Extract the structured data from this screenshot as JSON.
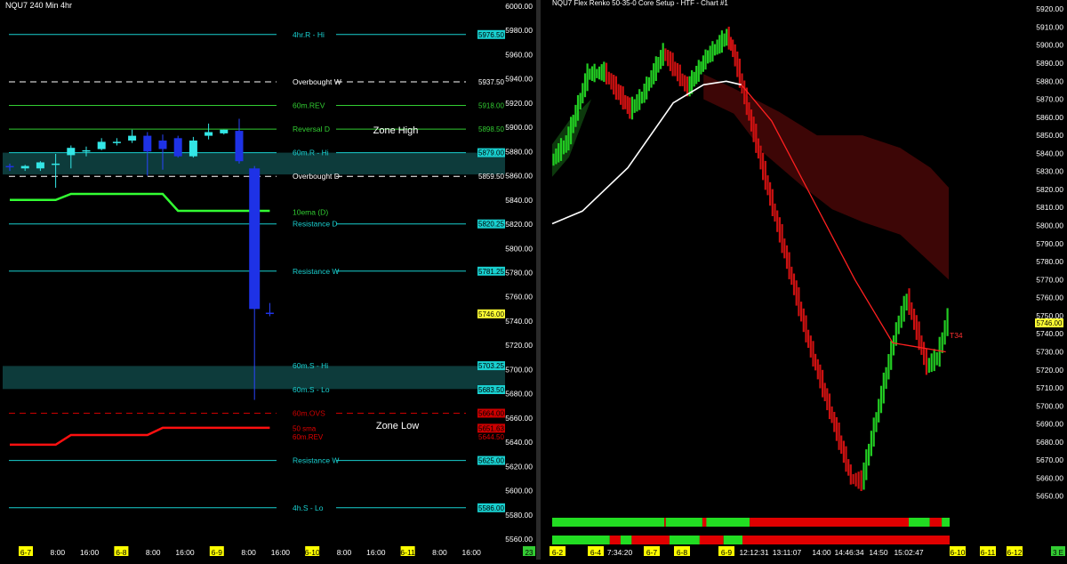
{
  "chart_data": [
    {
      "type": "candlestick",
      "title": "NQU7 240 Min  4hr",
      "ylim": [
        5555,
        6005
      ],
      "y_ticks": [
        6000,
        5980,
        5960,
        5940,
        5920,
        5900,
        5880,
        5860,
        5840,
        5820,
        5800,
        5780,
        5760,
        5740,
        5720,
        5700,
        5680,
        5660,
        5640,
        5620,
        5600,
        5580,
        5560
      ],
      "y_tick_labels": [
        "6000.00",
        "5980.00",
        "5960.00",
        "5940.00",
        "5920.00",
        "5900.00",
        "5880.00",
        "5860.00",
        "5840.00",
        "5820.00",
        "5800.00",
        "5780.00",
        "5760.00",
        "5740.00",
        "5720.00",
        "5700.00",
        "5680.00",
        "5660.00",
        "5640.00",
        "5620.00",
        "5600.00",
        "5580.00",
        "5560.00"
      ],
      "x_ticks": [
        {
          "label": "6-7",
          "highlight": true
        },
        {
          "label": "8:00",
          "highlight": false
        },
        {
          "label": "16:00",
          "highlight": false
        },
        {
          "label": "6-8",
          "highlight": true
        },
        {
          "label": "8:00",
          "highlight": false
        },
        {
          "label": "16:00",
          "highlight": false
        },
        {
          "label": "6-9",
          "highlight": true
        },
        {
          "label": "8:00",
          "highlight": false
        },
        {
          "label": "16:00",
          "highlight": false
        },
        {
          "label": "6-10",
          "highlight": true
        },
        {
          "label": "8:00",
          "highlight": false
        },
        {
          "label": "16:00",
          "highlight": false
        },
        {
          "label": "6-11",
          "highlight": true
        },
        {
          "label": "8:00",
          "highlight": false
        },
        {
          "label": "16:00",
          "highlight": false
        }
      ],
      "corner_label": "23",
      "candles": [
        {
          "o": 5868,
          "h": 5870,
          "l": 5864,
          "c": 5867
        },
        {
          "o": 5866,
          "h": 5869,
          "l": 5864,
          "c": 5868
        },
        {
          "o": 5866,
          "h": 5872,
          "l": 5864,
          "c": 5871
        },
        {
          "o": 5869,
          "h": 5878,
          "l": 5850,
          "c": 5870
        },
        {
          "o": 5877,
          "h": 5885,
          "l": 5866,
          "c": 5883
        },
        {
          "o": 5880,
          "h": 5884,
          "l": 5876,
          "c": 5881
        },
        {
          "o": 5882,
          "h": 5891,
          "l": 5881,
          "c": 5888
        },
        {
          "o": 5887,
          "h": 5891,
          "l": 5885,
          "c": 5888
        },
        {
          "o": 5889,
          "h": 5898,
          "l": 5887,
          "c": 5893
        },
        {
          "o": 5893,
          "h": 5896,
          "l": 5860,
          "c": 5880
        },
        {
          "o": 5889,
          "h": 5894,
          "l": 5865,
          "c": 5882
        },
        {
          "o": 5891,
          "h": 5893,
          "l": 5875,
          "c": 5876
        },
        {
          "o": 5876,
          "h": 5892,
          "l": 5875,
          "c": 5889
        },
        {
          "o": 5893,
          "h": 5903,
          "l": 5890,
          "c": 5896
        },
        {
          "o": 5895,
          "h": 5898,
          "l": 5894,
          "c": 5898
        },
        {
          "o": 5897,
          "h": 5907,
          "l": 5870,
          "c": 5872
        },
        {
          "o": 5866,
          "h": 5868,
          "l": 5675,
          "c": 5750
        },
        {
          "o": 5747,
          "h": 5755,
          "l": 5744,
          "c": 5746
        }
      ],
      "zones": [
        {
          "name": "Zone High",
          "from": 5861,
          "to": 5879
        },
        {
          "name": "Zone Low",
          "from": 5684,
          "to": 5703
        }
      ],
      "zone_labels": [
        "Zone High",
        "Zone Low"
      ],
      "levels": [
        {
          "label": "4hr.R - Hi",
          "value": 5976.5,
          "value_label": "5976.50",
          "color": "#19d0d0",
          "style": "solid",
          "badge": true
        },
        {
          "label": "Overbought W",
          "value": 5937.5,
          "value_label": "5937.50",
          "color": "#ffffff",
          "style": "dashed",
          "badge": false
        },
        {
          "label": "60m.REV",
          "value": 5918,
          "value_label": "5918.00",
          "color": "#32cd32",
          "style": "solid",
          "badge": false
        },
        {
          "label": "Reversal D",
          "value": 5898.5,
          "value_label": "5898.50",
          "color": "#32cd32",
          "style": "solid",
          "badge": false
        },
        {
          "label": "60m.R - Hi",
          "value": 5879,
          "value_label": "5879.00",
          "color": "#19d0d0",
          "style": "solid",
          "badge": true
        },
        {
          "label": "Overbought D",
          "value": 5859.5,
          "value_label": "5859.50",
          "color": "#ffffff",
          "style": "dashed",
          "badge": false
        },
        {
          "label": "Resistance D",
          "value": 5820.25,
          "value_label": "5820.25",
          "color": "#19d0d0",
          "style": "solid",
          "badge": true
        },
        {
          "label": "Resistance W",
          "value": 5781.25,
          "value_label": "5781.25",
          "color": "#19d0d0",
          "style": "solid",
          "badge": true
        },
        {
          "label": "60m.S - Hi",
          "value": 5703.25,
          "value_label": "5703.25",
          "color": "#19d0d0",
          "style": "none",
          "badge": true
        },
        {
          "label": "60m.S - Lo",
          "value": 5683.5,
          "value_label": "5683.50",
          "color": "#19d0d0",
          "style": "none",
          "badge": true
        },
        {
          "label": "60m.OVS",
          "value": 5664,
          "value_label": "5664.00",
          "color": "#cc0000",
          "style": "dashed",
          "badge": true
        },
        {
          "label": "Resistance W",
          "value": 5625,
          "value_label": "5625.00",
          "color": "#19d0d0",
          "style": "solid",
          "badge": true
        },
        {
          "label": "4h.S - Lo",
          "value": 5586,
          "value_label": "5586.00",
          "color": "#19d0d0",
          "style": "solid",
          "badge": true
        }
      ],
      "ema_label": {
        "label": "10ema (D)",
        "value": 5830
      },
      "sma_labels": [
        {
          "label": "50 sma",
          "value": 5651.63,
          "value_label": "5651.63"
        },
        {
          "label": "60m.REV",
          "value": 5644.5,
          "value_label": "5644.50"
        }
      ],
      "last_price": {
        "value": 5746,
        "value_label": "5746.00"
      },
      "ema_path": [
        [
          0,
          5840
        ],
        [
          3,
          5840
        ],
        [
          4,
          5845
        ],
        [
          10,
          5845
        ],
        [
          11,
          5831
        ],
        [
          17,
          5831
        ]
      ],
      "sma_path": [
        [
          0,
          5638
        ],
        [
          3,
          5638
        ],
        [
          4,
          5646
        ],
        [
          9,
          5646
        ],
        [
          10,
          5652
        ],
        [
          17,
          5652
        ]
      ]
    },
    {
      "type": "renko",
      "title": "NQU7 Flex Renko 50-35-0 Core Setup - HTF - Chart #1",
      "ylim": [
        5641,
        5925
      ],
      "y_ticks": [
        5920,
        5910,
        5900,
        5890,
        5880,
        5870,
        5860,
        5850,
        5840,
        5830,
        5820,
        5810,
        5800,
        5790,
        5780,
        5770,
        5760,
        5750,
        5740,
        5730,
        5720,
        5710,
        5700,
        5690,
        5680,
        5670,
        5660,
        5650
      ],
      "y_tick_labels": [
        "5920.00",
        "5910.00",
        "5900.00",
        "5890.00",
        "5880.00",
        "5870.00",
        "5860.00",
        "5850.00",
        "5840.00",
        "5830.00",
        "5820.00",
        "5810.00",
        "5800.00",
        "5790.00",
        "5780.00",
        "5770.00",
        "5760.00",
        "5750.00",
        "5740.00",
        "5730.00",
        "5720.00",
        "5710.00",
        "5700.00",
        "5690.00",
        "5680.00",
        "5670.00",
        "5660.00",
        "5650.00"
      ],
      "x_ticks": [
        {
          "label": "6-2",
          "highlight": true
        },
        {
          "label": "6-4",
          "highlight": true
        },
        {
          "label": "7:34:20",
          "highlight": false
        },
        {
          "label": "6-7",
          "highlight": true
        },
        {
          "label": "6-8",
          "highlight": true
        },
        {
          "label": "6-9",
          "highlight": true
        },
        {
          "label": "12:12:31",
          "highlight": false
        },
        {
          "label": "13:11:07",
          "highlight": false
        },
        {
          "label": "14:00",
          "highlight": false
        },
        {
          "label": "14:46:34",
          "highlight": false
        },
        {
          "label": "14:50",
          "highlight": false
        },
        {
          "label": "15:02:47",
          "highlight": false
        },
        {
          "label": "6-10",
          "highlight": true
        },
        {
          "label": "6-11",
          "highlight": true
        },
        {
          "label": "6-12",
          "highlight": true
        }
      ],
      "corner_label": "3 E",
      "last_price": {
        "value": 5746,
        "value_label": "5746.00"
      },
      "level_label": {
        "label": "T34",
        "value": 5739
      },
      "price_path": [
        [
          0,
          5836
        ],
        [
          10,
          5846
        ],
        [
          24,
          5884
        ],
        [
          35,
          5885
        ],
        [
          43,
          5875
        ],
        [
          52,
          5864
        ],
        [
          60,
          5872
        ],
        [
          74,
          5896
        ],
        [
          90,
          5876
        ],
        [
          102,
          5893
        ],
        [
          116,
          5905
        ],
        [
          120,
          5897
        ],
        [
          140,
          5830
        ],
        [
          170,
          5735
        ],
        [
          198,
          5660
        ],
        [
          205,
          5658
        ],
        [
          228,
          5743
        ],
        [
          235,
          5760
        ],
        [
          248,
          5722
        ],
        [
          255,
          5727
        ],
        [
          262,
          5749
        ]
      ],
      "ma_path": [
        [
          0,
          5801
        ],
        [
          20,
          5808
        ],
        [
          50,
          5832
        ],
        [
          80,
          5868
        ],
        [
          100,
          5878
        ],
        [
          115,
          5880
        ],
        [
          125,
          5878
        ],
        [
          145,
          5858
        ],
        [
          170,
          5818
        ],
        [
          200,
          5770
        ],
        [
          225,
          5735
        ],
        [
          260,
          5730
        ]
      ],
      "cloud": {
        "top": [
          [
            100,
            5884
          ],
          [
            120,
            5876
          ],
          [
            150,
            5863
          ],
          [
            175,
            5850
          ],
          [
            205,
            5850
          ],
          [
            230,
            5843
          ],
          [
            250,
            5832
          ],
          [
            262,
            5821
          ]
        ],
        "bottom": [
          [
            100,
            5870
          ],
          [
            120,
            5862
          ],
          [
            140,
            5840
          ],
          [
            165,
            5822
          ],
          [
            185,
            5809
          ],
          [
            205,
            5802
          ],
          [
            230,
            5795
          ],
          [
            262,
            5770
          ]
        ]
      },
      "signal_bars": [
        {
          "name": "bar-1",
          "segments": [
            {
              "from": 0,
              "to": 0.282,
              "color": "green"
            },
            {
              "from": 0.282,
              "to": 0.286,
              "color": "red"
            },
            {
              "from": 0.286,
              "to": 0.378,
              "color": "green"
            },
            {
              "from": 0.378,
              "to": 0.388,
              "color": "red"
            },
            {
              "from": 0.388,
              "to": 0.497,
              "color": "green"
            },
            {
              "from": 0.497,
              "to": 0.897,
              "color": "red"
            },
            {
              "from": 0.897,
              "to": 0.95,
              "color": "green"
            },
            {
              "from": 0.95,
              "to": 0.98,
              "color": "red"
            },
            {
              "from": 0.98,
              "to": 1,
              "color": "green"
            }
          ]
        },
        {
          "name": "bar-2",
          "segments": [
            {
              "from": 0,
              "to": 0.145,
              "color": "green"
            },
            {
              "from": 0.145,
              "to": 0.172,
              "color": "red"
            },
            {
              "from": 0.172,
              "to": 0.2,
              "color": "green"
            },
            {
              "from": 0.2,
              "to": 0.295,
              "color": "red"
            },
            {
              "from": 0.295,
              "to": 0.371,
              "color": "green"
            },
            {
              "from": 0.371,
              "to": 0.431,
              "color": "red"
            },
            {
              "from": 0.431,
              "to": 0.479,
              "color": "green"
            },
            {
              "from": 0.479,
              "to": 1,
              "color": "red"
            }
          ]
        }
      ]
    }
  ],
  "colors": {
    "background": "#000000",
    "axis_text": "#ffffff",
    "cyan": "#19d0d0",
    "green": "#32cd32",
    "red": "#e00000",
    "candle_up": "#33e6e6",
    "candle_down": "#1e32e6",
    "zone_fill": "#0d3b3b",
    "renko_up": "#22cc22",
    "renko_down": "#cc1111",
    "cloud": "#3d0606",
    "highlight_tick": "#ffff00"
  }
}
